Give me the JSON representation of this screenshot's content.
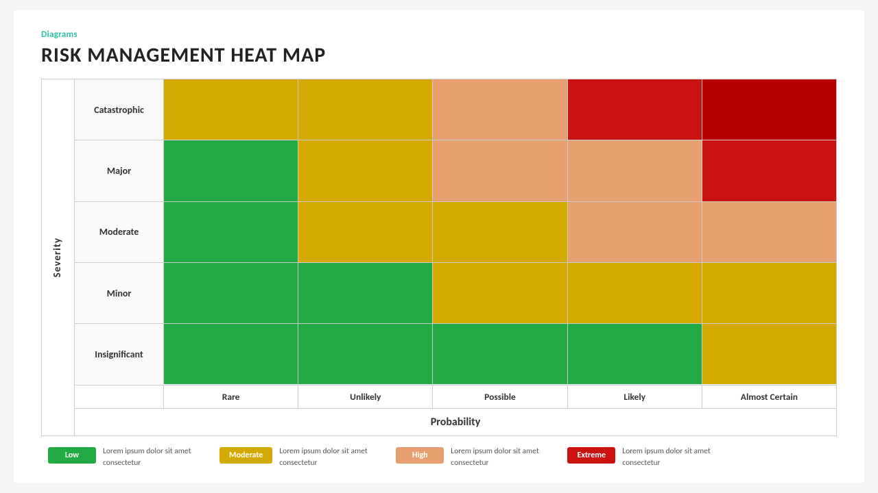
{
  "header": {
    "section_label": "Diagrams",
    "title": "RISK MANAGEMENT HEAT MAP"
  },
  "matrix": {
    "severity_label": "Severity",
    "probability_label": "Probability",
    "rows": [
      {
        "label": "Catastrophic"
      },
      {
        "label": "Major"
      },
      {
        "label": "Moderate"
      },
      {
        "label": "Minor"
      },
      {
        "label": "Insignificant"
      }
    ],
    "columns": [
      {
        "label": "Rare"
      },
      {
        "label": "Unlikely"
      },
      {
        "label": "Possible"
      },
      {
        "label": "Likely"
      },
      {
        "label": "Almost Certain"
      }
    ]
  },
  "legend": [
    {
      "badge_label": "Low",
      "badge_color": "#22aa44",
      "description": "Lorem ipsum dolor sit amet consectetur"
    },
    {
      "badge_label": "Moderate",
      "badge_color": "#d4aa00",
      "description": "Lorem ipsum dolor sit amet consectetur"
    },
    {
      "badge_label": "High",
      "badge_color": "#e8a070",
      "description": "Lorem ipsum dolor sit amet consectetur"
    },
    {
      "badge_label": "Extreme",
      "badge_color": "#cc1111",
      "description": "Lorem ipsum dolor sit amet consectetur"
    }
  ]
}
